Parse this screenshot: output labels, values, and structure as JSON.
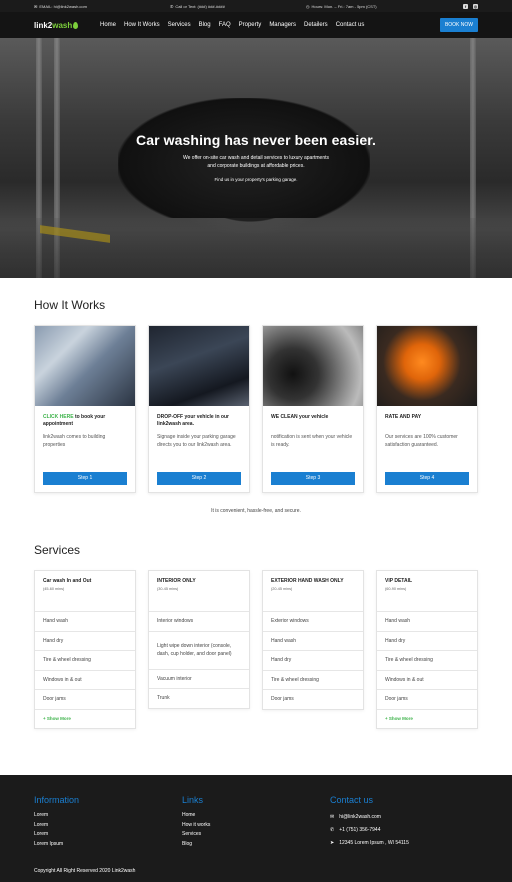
{
  "topbar": {
    "email": "EMAIL: hi@link2wash.com",
    "call": "Call or Text: (###) ###-####",
    "hours": "Hours: Mon. – Fri.: 7am - 5pm (CST)",
    "social_icons": [
      "facebook-icon",
      "instagram-icon"
    ]
  },
  "nav": {
    "logo_part1": "link2",
    "logo_part2": "wash",
    "items": [
      "Home",
      "How It Works",
      "Services",
      "Blog",
      "FAQ",
      "Property",
      "Managers",
      "Detailers",
      "Contact us"
    ],
    "book_label": "BOOK NOW"
  },
  "hero": {
    "title": "Car washing has never been easier.",
    "line1": "We offer on-site car wash and detail services to luxury apartments",
    "line2": "and corporate buildings at affordable prices.",
    "sub": "Find us in your property's parking garage."
  },
  "how": {
    "heading": "How It Works",
    "steps": [
      {
        "title_prefix": "CLICK HERE",
        "title": "to book your appointment",
        "desc": "link2wash comes to building properties",
        "button": "Step 1"
      },
      {
        "title_prefix": "",
        "title": "DROP-OFF your vehicle in our link2wash area.",
        "desc": "Signage inside your parking garage directs you to our link2wash area.",
        "button": "Step 2"
      },
      {
        "title_prefix": "",
        "title": "WE CLEAN your vehicle",
        "desc": "notification is sent when your vehicle is ready.",
        "button": "Step 3"
      },
      {
        "title_prefix": "",
        "title": "RATE AND PAY",
        "desc": "Our services are 100% customer satisfaction guaranteed.",
        "button": "Step 4"
      }
    ],
    "tagline": "It is convenient, hassle-free, and secure."
  },
  "services": {
    "heading": "Services",
    "cards": [
      {
        "name": "Car wash In and Out",
        "mins": "(45-60 mins)",
        "items": [
          "Hand wash",
          "Hand dry",
          "Tire & wheel dressing",
          "Windows in & out",
          "Door jams"
        ],
        "more": "+ Show More"
      },
      {
        "name": "INTERIOR ONLY",
        "mins": "(30-45 mins)",
        "items": [
          "Interior windows",
          "Light wipe down interior (console, dash, cup holder, and door panel)",
          "Vacuum interior",
          "Trunk"
        ],
        "more": ""
      },
      {
        "name": "EXTERIOR HAND WASH ONLY",
        "mins": "(20-45 mins)",
        "items": [
          "Exterior windows",
          "Hand wash",
          "Hand dry",
          "Tire & wheel dressing",
          "Door jams"
        ],
        "more": ""
      },
      {
        "name": "VIP DETAIL",
        "mins": "(60-90 mins)",
        "items": [
          "Hand wash",
          "Hand dry",
          "Tire & wheel dressing",
          "Windows in & out",
          "Door jams"
        ],
        "more": "+ Show More"
      }
    ]
  },
  "footer": {
    "info_heading": "Information",
    "info_items": [
      "Lorem",
      "Lorem",
      "Lorem",
      "Lorem Ipsum"
    ],
    "links_heading": "Links",
    "links_items": [
      "Home",
      "How it works",
      "Services",
      "Blog"
    ],
    "contact_heading": "Contact us",
    "contact_email": "hi@link2wash.com",
    "contact_phone": "+1 (751) 356-7944",
    "contact_address": "12345 Lorem Ipsum , WI 54115",
    "copyright": "Copyright All Right Reserved 2020 Link2wash"
  },
  "colors": {
    "accent": "#1a7fd1",
    "green": "#3eb34b",
    "dark": "#1b1b1b"
  }
}
